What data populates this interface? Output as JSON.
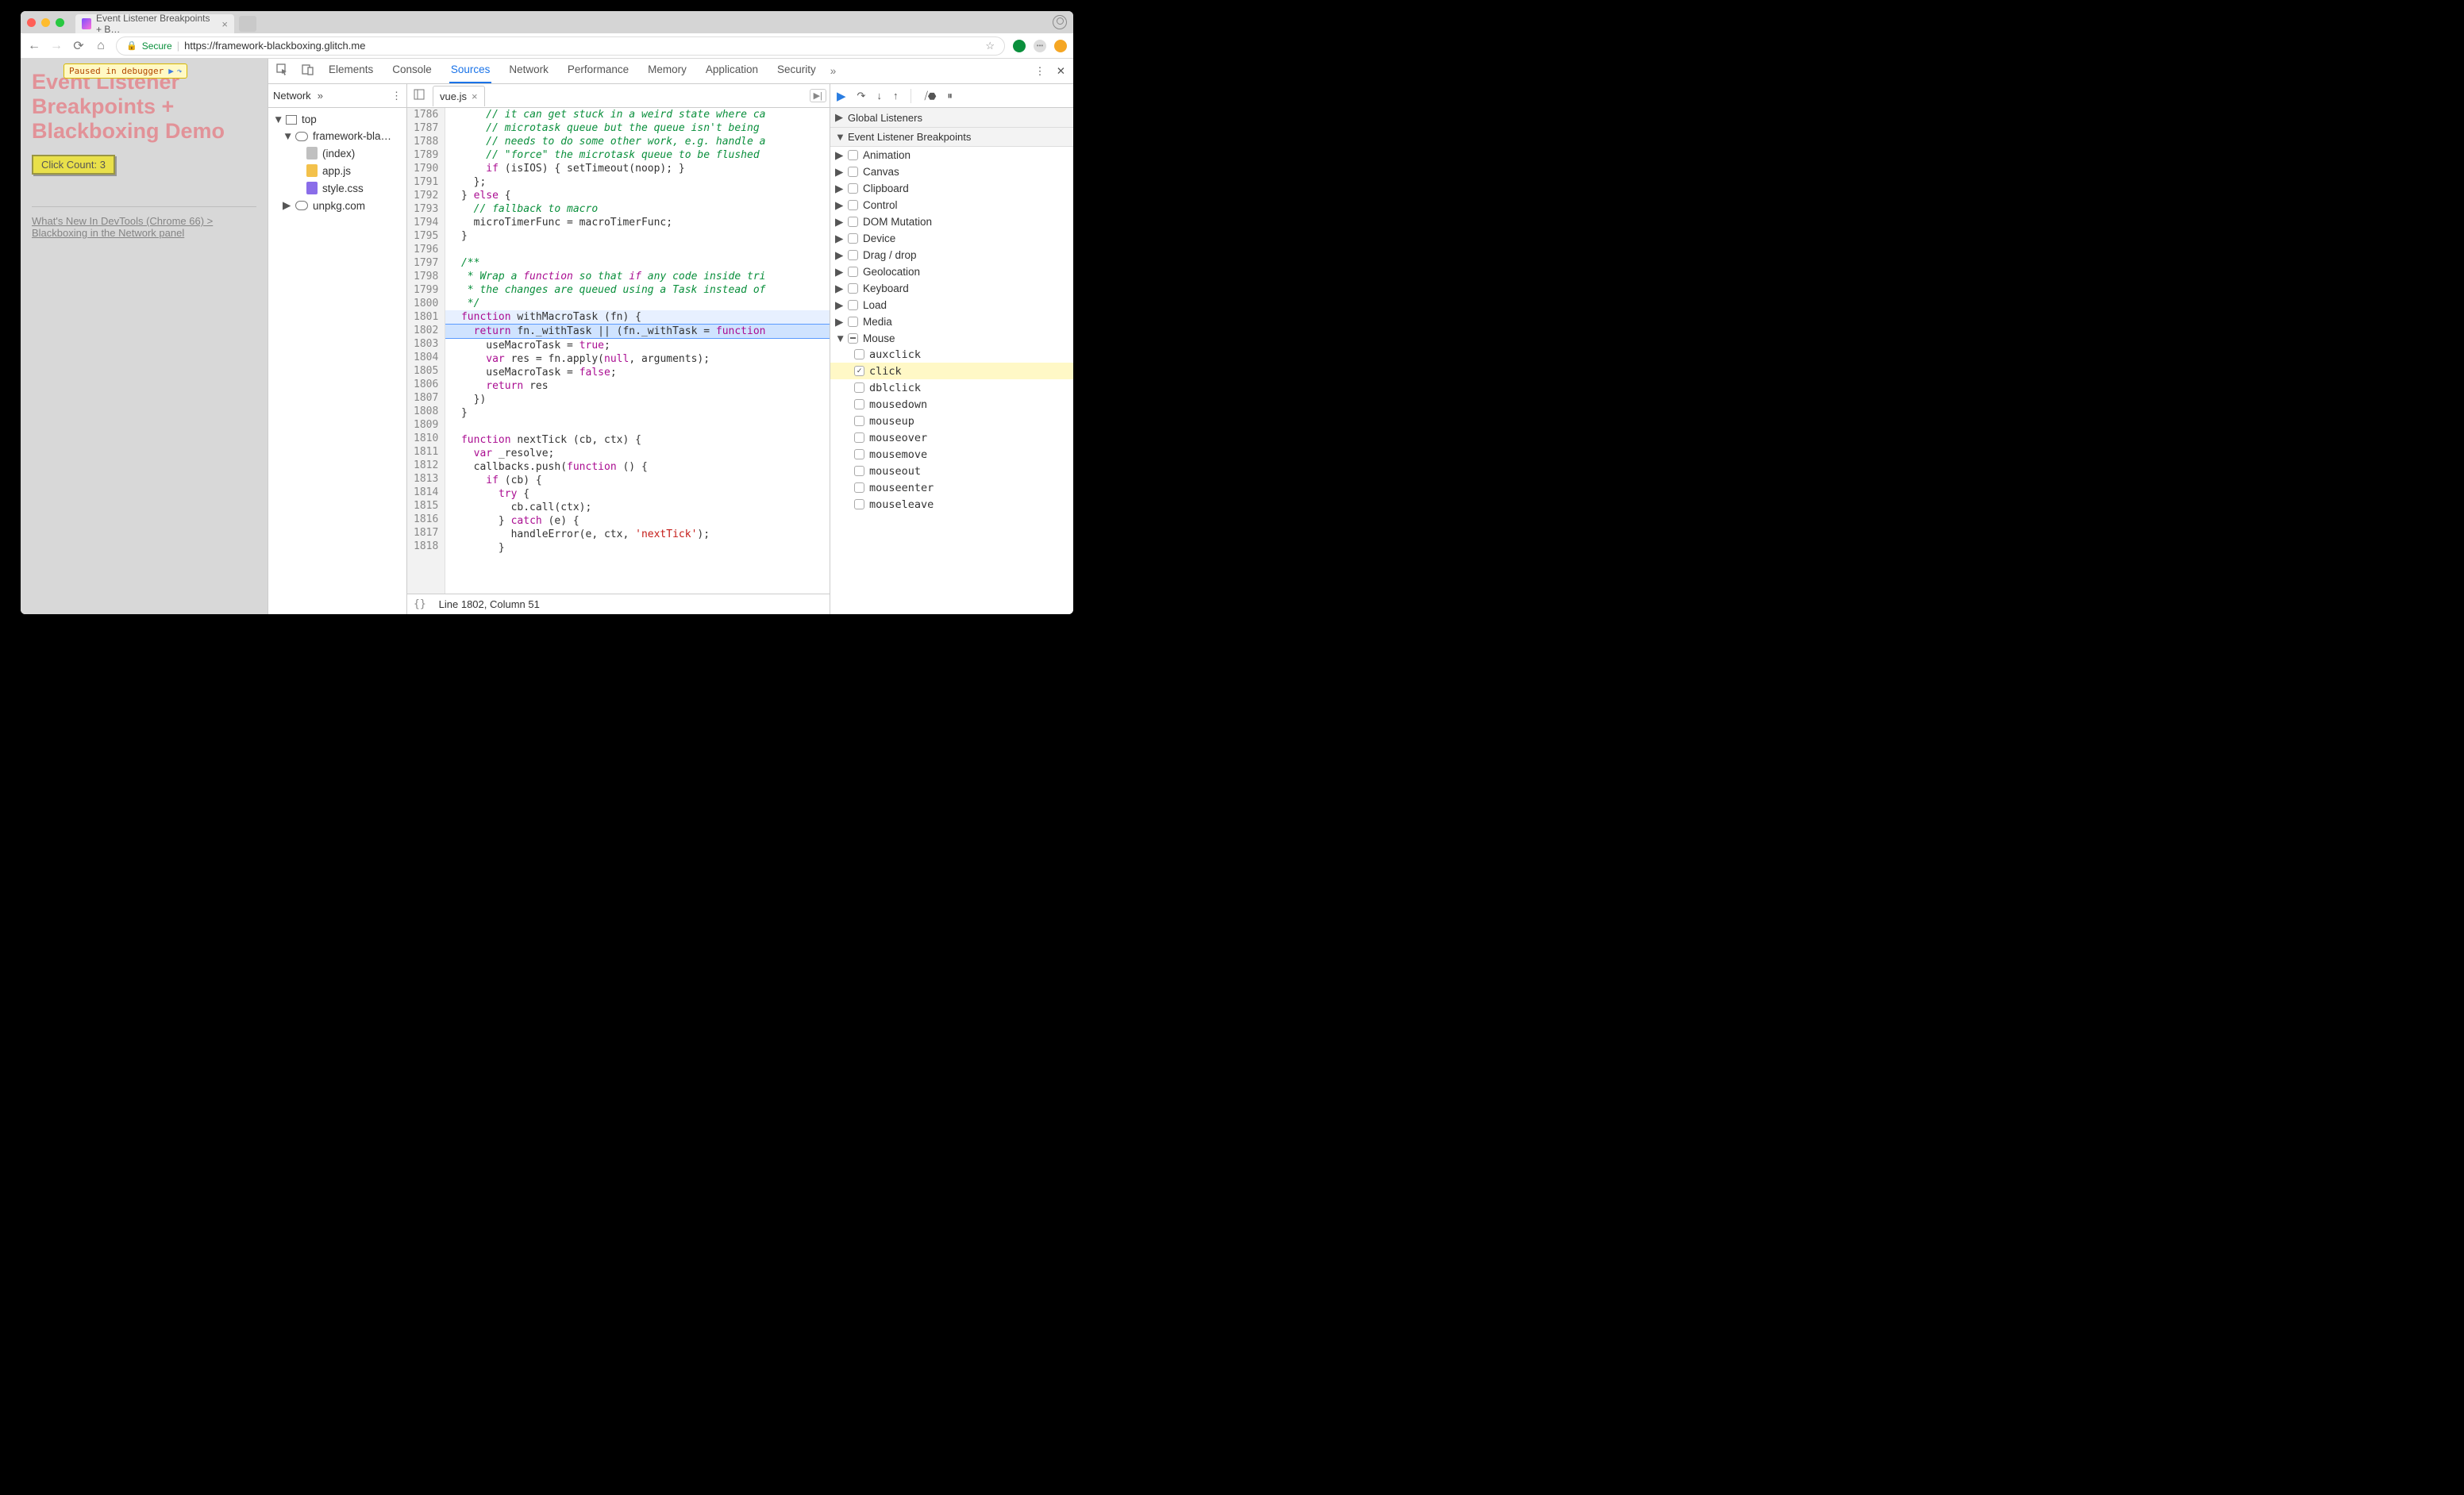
{
  "browser": {
    "tab_title": "Event Listener Breakpoints + B…",
    "secure_label": "Secure",
    "url": "https://framework-blackboxing.glitch.me"
  },
  "page": {
    "paused_label": "Paused in debugger",
    "heading": "Event Listener Breakpoints + Blackboxing Demo",
    "button_label": "Click Count: 3",
    "link_text": "What's New In DevTools (Chrome 66) > Blackboxing in the Network panel"
  },
  "devtools": {
    "panels": [
      "Elements",
      "Console",
      "Sources",
      "Network",
      "Performance",
      "Memory",
      "Application",
      "Security"
    ],
    "active_panel": "Sources",
    "navigator_tab": "Network",
    "tree": {
      "top": "top",
      "domain": "framework-bla…",
      "files": [
        "(index)",
        "app.js",
        "style.css"
      ],
      "external": "unpkg.com"
    },
    "open_file": "vue.js",
    "gutter_start": 1786,
    "gutter_end": 1818,
    "code_lines": [
      "      // it can get stuck in a weird state where ca",
      "      // microtask queue but the queue isn't being ",
      "      // needs to do some other work, e.g. handle a",
      "      // \"force\" the microtask queue to be flushed ",
      "      if (isIOS) { setTimeout(noop); }",
      "    };",
      "  } else {",
      "    // fallback to macro",
      "    microTimerFunc = macroTimerFunc;",
      "  }",
      "",
      "  /**",
      "   * Wrap a function so that if any code inside tri",
      "   * the changes are queued using a Task instead of",
      "   */",
      "  function withMacroTask (fn) {",
      "    return fn._withTask || (fn._withTask = function",
      "      useMacroTask = true;",
      "      var res = fn.apply(null, arguments);",
      "      useMacroTask = false;",
      "      return res",
      "    })",
      "  }",
      "",
      "  function nextTick (cb, ctx) {",
      "    var _resolve;",
      "    callbacks.push(function () {",
      "      if (cb) {",
      "        try {",
      "          cb.call(ctx);",
      "        } catch (e) {",
      "          handleError(e, ctx, 'nextTick');",
      "        }"
    ],
    "status_line": "Line 1802, Column 51",
    "panes": {
      "global": "Global Listeners",
      "breakpoints": "Event Listener Breakpoints"
    },
    "categories": [
      "Animation",
      "Canvas",
      "Clipboard",
      "Control",
      "DOM Mutation",
      "Device",
      "Drag / drop",
      "Geolocation",
      "Keyboard",
      "Load",
      "Media",
      "Mouse"
    ],
    "mouse_events": [
      "auxclick",
      "click",
      "dblclick",
      "mousedown",
      "mouseup",
      "mouseover",
      "mousemove",
      "mouseout",
      "mouseenter",
      "mouseleave"
    ],
    "checked_event": "click"
  }
}
